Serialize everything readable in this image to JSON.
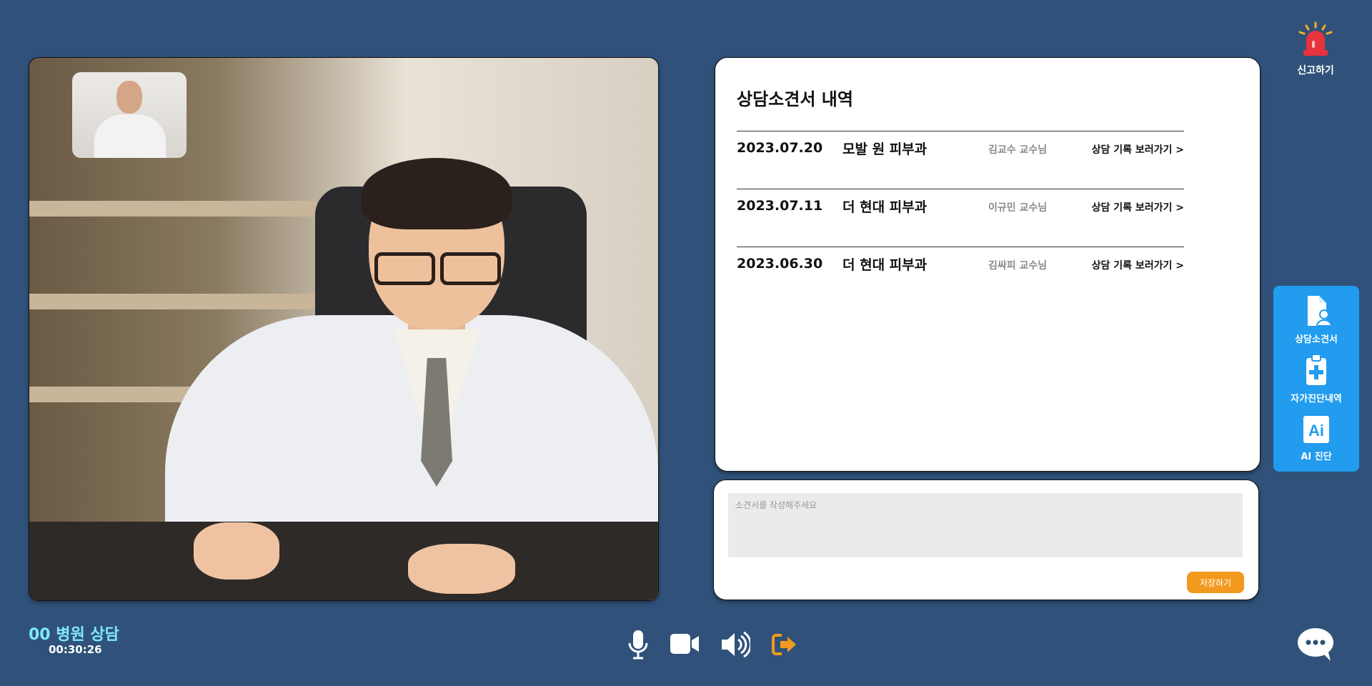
{
  "video": {
    "main_description": "doctor video feed",
    "self_view": "patient self view"
  },
  "record_panel": {
    "title": "상담소견서 내역",
    "records": [
      {
        "date": "2023.07.20",
        "hospital": "모발 원 피부과",
        "doctor": "김교수 교수님",
        "link": "상담 기록 보러가기 >"
      },
      {
        "date": "2023.07.11",
        "hospital": "더 현대 피부과",
        "doctor": "이규민 교수님",
        "link": "상담 기록 보러가기 >"
      },
      {
        "date": "2023.06.30",
        "hospital": "더 현대 피부과",
        "doctor": "김싸피 교수님",
        "link": "상담 기록 보러가기 >"
      }
    ]
  },
  "note": {
    "placeholder": "소견서를 작성해주세요",
    "save_label": "저장하기"
  },
  "report": {
    "label": "신고하기",
    "icon": "siren-icon"
  },
  "side_menu": {
    "items": [
      {
        "label": "상담소견서",
        "icon": "document-user-icon"
      },
      {
        "label": "자가진단내역",
        "icon": "clipboard-medical-icon"
      },
      {
        "label": "AI 진단",
        "icon_text": "Ai",
        "icon": "ai-icon"
      }
    ]
  },
  "call": {
    "title": "00 병원 상담",
    "timer": "00:30:26"
  },
  "controls": {
    "mic": "microphone-icon",
    "camera": "video-camera-icon",
    "speaker": "speaker-icon",
    "leave": "leave-icon",
    "chat": "chat-icon"
  },
  "colors": {
    "background": "#30527a",
    "accent_blue": "#219cef",
    "accent_orange": "#f29a1e",
    "title_cyan": "#7fe8ff"
  }
}
